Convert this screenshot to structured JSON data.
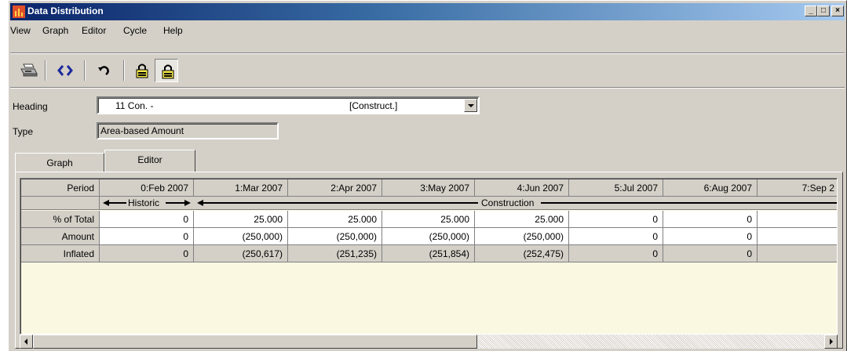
{
  "window": {
    "title": "Data Distribution",
    "min": "_",
    "max": "□",
    "close": "×"
  },
  "menu": [
    "View",
    "Graph",
    "Editor",
    "Cycle",
    "Help"
  ],
  "toolbar": {
    "icons": [
      "printer-icon",
      "refresh-icon",
      "undo-icon",
      "lock-icon",
      "unlock-icon"
    ]
  },
  "form": {
    "heading_label": "Heading",
    "heading_code": "11 Con. -",
    "heading_desc": "[Construct.]",
    "type_label": "Type",
    "type_value": "Area-based Amount"
  },
  "tabs": [
    {
      "label": "Graph",
      "active": false
    },
    {
      "label": "Editor",
      "active": true
    }
  ],
  "table": {
    "row_headers": [
      "Period",
      "% of Total",
      "Amount",
      "Inflated"
    ],
    "periods": [
      "0:Feb 2007",
      "1:Mar 2007",
      "2:Apr 2007",
      "3:May 2007",
      "4:Jun 2007",
      "5:Jul 2007",
      "6:Aug 2007",
      "7:Sep 2"
    ],
    "phases": {
      "historic": "Historic",
      "construction": "Construction"
    },
    "pct_of_total": [
      "0",
      "25.000",
      "25.000",
      "25.000",
      "25.000",
      "0",
      "0",
      ""
    ],
    "amount": [
      "0",
      "(250,000)",
      "(250,000)",
      "(250,000)",
      "(250,000)",
      "0",
      "0",
      ""
    ],
    "inflated": [
      "0",
      "(250,617)",
      "(251,235)",
      "(251,854)",
      "(252,475)",
      "0",
      "0",
      ""
    ]
  },
  "colors": {
    "window_bg": "#d4d0c8",
    "grid_bg": "#fbf8e2",
    "title_start": "#0a246a",
    "title_end": "#a6caf0"
  }
}
